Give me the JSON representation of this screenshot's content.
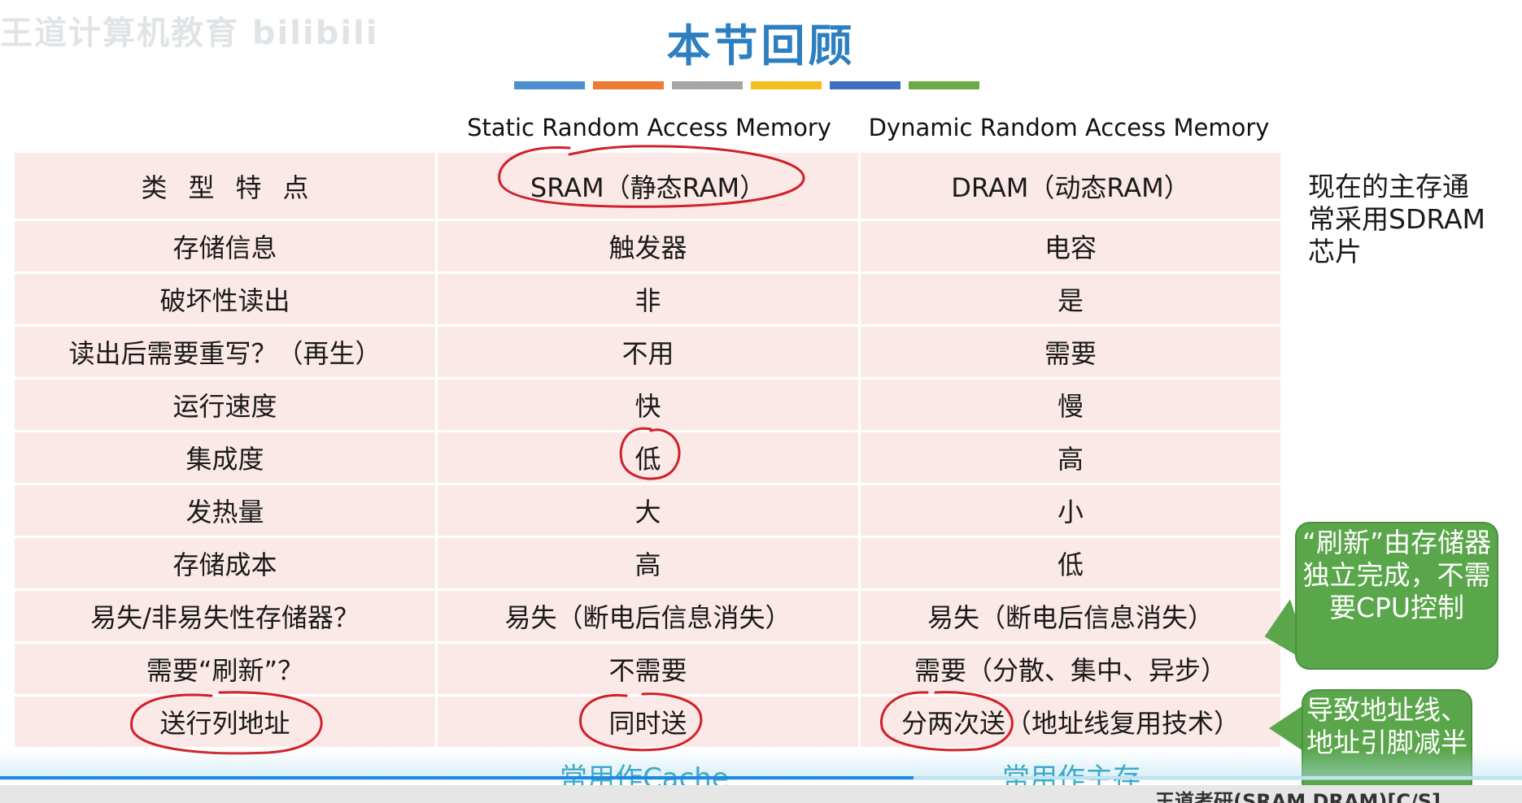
{
  "watermark": "王道计算机教育 bilibili",
  "title": "本节回顾",
  "colors": {
    "title": "#2e7fc0",
    "row_bg": "#fbe9e7",
    "annotation_red": "#d0202a",
    "bubble_green": "#5aa64a",
    "cyan_label": "#3fa9c9",
    "progress": "#1e88e5",
    "colorbar": [
      "#4f8fd0",
      "#ef7a35",
      "#a5a5a5",
      "#f5be1e",
      "#3f6fc2",
      "#6aaa47"
    ]
  },
  "column_headers": {
    "sram": "Static Random Access Memory",
    "dram": "Dynamic Random Access Memory"
  },
  "table": {
    "rows": [
      {
        "label": "类型特点",
        "sram": "SRAM（静态RAM）",
        "dram": "DRAM（动态RAM）"
      },
      {
        "label": "存储信息",
        "sram": "触发器",
        "dram": "电容"
      },
      {
        "label": "破坏性读出",
        "sram": "非",
        "dram": "是"
      },
      {
        "label": "读出后需要重写？（再生）",
        "sram": "不用",
        "dram": "需要"
      },
      {
        "label": "运行速度",
        "sram": "快",
        "dram": "慢"
      },
      {
        "label": "集成度",
        "sram": "低",
        "dram": "高"
      },
      {
        "label": "发热量",
        "sram": "大",
        "dram": "小"
      },
      {
        "label": "存储成本",
        "sram": "高",
        "dram": "低"
      },
      {
        "label": "易失/非易失性存储器？",
        "sram": "易失（断电后信息消失）",
        "dram": "易失（断电后信息消失）"
      },
      {
        "label": "需要“刷新”？",
        "sram": "不需要",
        "dram": "需要（分散、集中、异步）"
      },
      {
        "label": "送行列地址",
        "sram": "同时送",
        "dram": "分两次送（地址线复用技术）"
      }
    ]
  },
  "side_note": "现在的主存通常采用SDRAM芯片",
  "bubbles": {
    "refresh": "“刷新”由存储器独立完成，不需要CPU控制",
    "address": "导致地址线、地址引脚减半"
  },
  "bottom_labels": {
    "sram": "常用作Cache",
    "dram": "常用作主存"
  },
  "footer_cut_text": "王道考研(SRAM DRAM)[C/S]",
  "video_progress": 0.6
}
